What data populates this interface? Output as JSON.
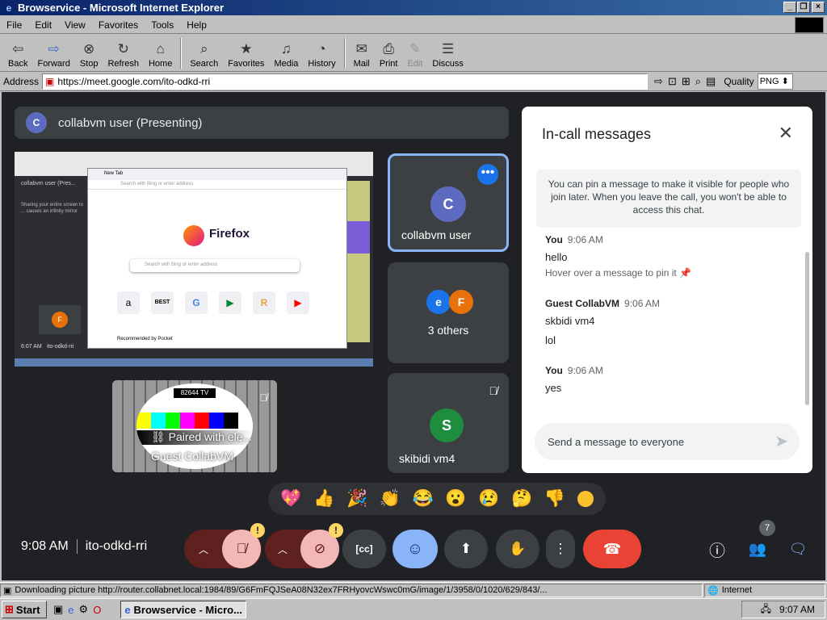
{
  "window": {
    "title": "Browservice - Microsoft Internet Explorer"
  },
  "menu": [
    "File",
    "Edit",
    "View",
    "Favorites",
    "Tools",
    "Help"
  ],
  "toolbar": {
    "back": "Back",
    "forward": "Forward",
    "stop": "Stop",
    "refresh": "Refresh",
    "home": "Home",
    "search": "Search",
    "favorites": "Favorites",
    "media": "Media",
    "history": "History",
    "mail": "Mail",
    "print": "Print",
    "edit": "Edit",
    "discuss": "Discuss"
  },
  "address": {
    "label": "Address",
    "url": "https://meet.google.com/ito-odkd-rri",
    "quality_label": "Quality",
    "quality_value": "PNG"
  },
  "meet": {
    "presenting": {
      "initial": "C",
      "name": "collabvm user (Presenting)"
    },
    "shared": {
      "browser_title": "Firefox",
      "tab_label": "New Tab",
      "search_placeholder": "Search with Bing or enter address",
      "time": "6:07 AM",
      "code": "ito-odkd-rri",
      "recommended": "Recommended by Pocket",
      "learn_more": "Learn more",
      "shortcuts": [
        "Amazon",
        "Best Buy",
        "@google",
        "meet.google",
        "add.dll",
        "youtube"
      ],
      "top_text": "collabvm user (Pres...",
      "presenting_text": "Sharing your entire screen to ... causes an infinity mirror"
    },
    "tiles": [
      {
        "initial": "C",
        "name": "collabvm user"
      },
      {
        "initials": [
          "e",
          "F"
        ],
        "name": "3 others"
      },
      {
        "initial": "S",
        "name": "skibidi vm4"
      }
    ],
    "guest": {
      "banner": "82644 TV",
      "paired": "Paired with ele...",
      "name": "Guest CollabVM"
    },
    "panel": {
      "title": "In-call messages",
      "note": "You can pin a message to make it visible for people who join later. When you leave the call, you won't be able to access this chat.",
      "messages": [
        {
          "sender": "You",
          "time": "9:06 AM",
          "lines": [
            "hello"
          ],
          "hint": "Hover over a message to pin it"
        },
        {
          "sender": "Guest CollabVM",
          "time": "9:06 AM",
          "lines": [
            "skbidi vm4",
            "lol"
          ]
        },
        {
          "sender": "You",
          "time": "9:06 AM",
          "lines": [
            "yes"
          ]
        }
      ],
      "input_placeholder": "Send a message to everyone"
    },
    "reactions": [
      "💖",
      "👍",
      "🎉",
      "👏",
      "😂",
      "😮",
      "😢",
      "🤔",
      "👎"
    ],
    "clock": "9:08 AM",
    "meeting_code": "ito-odkd-rri",
    "participant_count": "7"
  },
  "status": {
    "text": "Downloading picture http://router.collabnet.local:1984/89/G6FmFQJSeA08N32ex7FRHyovcWswc0mG/image/1/3958/0/1020/629/843/...",
    "zone": "Internet"
  },
  "taskbar": {
    "start": "Start",
    "task": "Browservice - Micro...",
    "time": "9:07 AM"
  }
}
